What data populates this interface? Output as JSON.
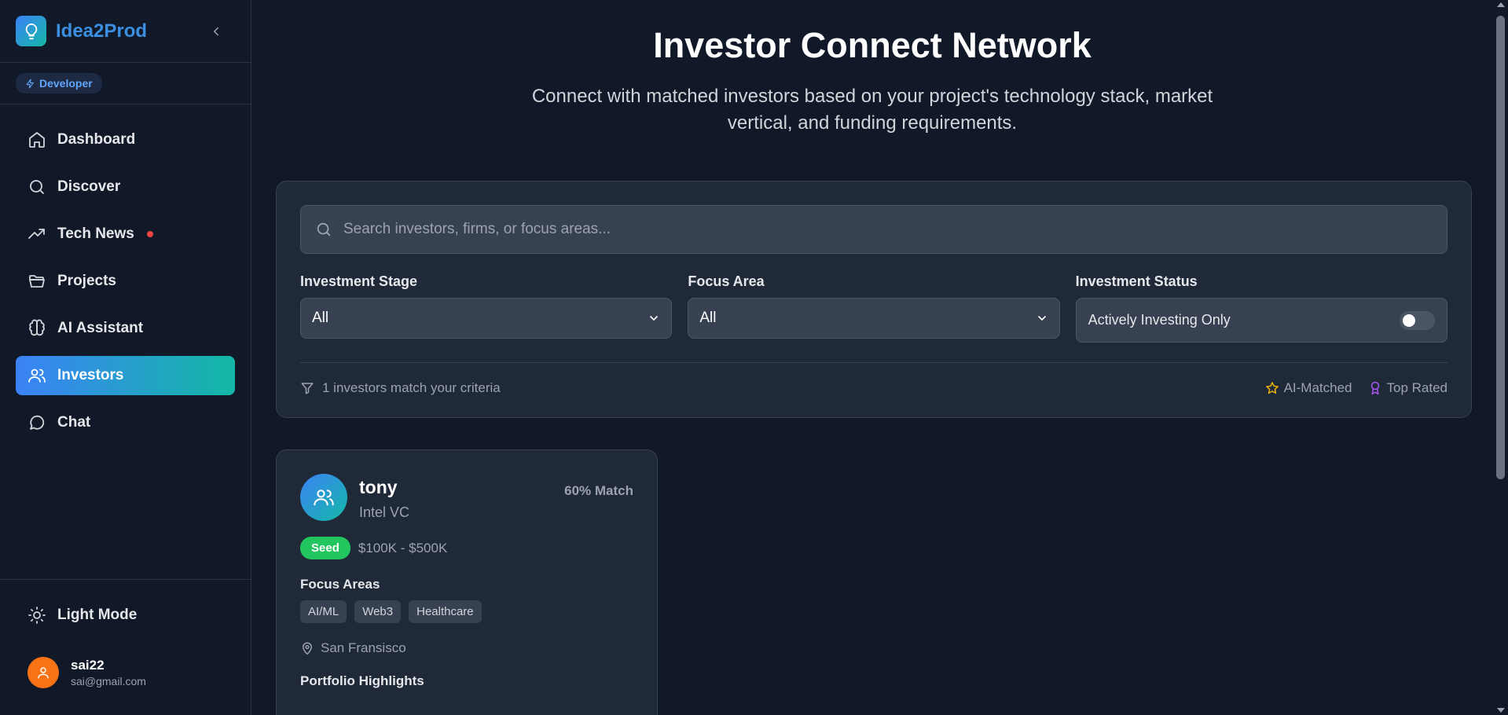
{
  "brand": {
    "name": "Idea2Prod"
  },
  "role": {
    "label": "Developer"
  },
  "nav": {
    "items": [
      {
        "label": "Dashboard",
        "icon": "home-icon"
      },
      {
        "label": "Discover",
        "icon": "search-icon"
      },
      {
        "label": "Tech News",
        "icon": "trending-icon"
      },
      {
        "label": "Projects",
        "icon": "folder-icon"
      },
      {
        "label": "AI Assistant",
        "icon": "brain-icon"
      },
      {
        "label": "Investors",
        "icon": "users-icon",
        "active": true
      },
      {
        "label": "Chat",
        "icon": "chat-icon"
      }
    ]
  },
  "sidebar_bottom": {
    "light_mode": "Light Mode",
    "user": {
      "name": "sai22",
      "email": "sai@gmail.com"
    }
  },
  "header": {
    "title": "Investor Connect Network",
    "subtitle": "Connect with matched investors based on your project's technology stack, market vertical, and funding requirements."
  },
  "filters": {
    "search_placeholder": "Search investors, firms, or focus areas...",
    "stage": {
      "label": "Investment Stage",
      "value": "All"
    },
    "focus": {
      "label": "Focus Area",
      "value": "All"
    },
    "status": {
      "label": "Investment Status",
      "toggle_label": "Actively Investing Only",
      "toggle_on": false
    },
    "result_text": "1 investors match your criteria",
    "legend": {
      "ai_matched": "AI-Matched",
      "top_rated": "Top Rated"
    }
  },
  "investor": {
    "name": "tony",
    "firm": "Intel VC",
    "match": "60% Match",
    "stage": "Seed",
    "range": "$100K - $500K",
    "focus_label": "Focus Areas",
    "focus_areas": [
      "AI/ML",
      "Web3",
      "Healthcare"
    ],
    "location": "San Fransisco",
    "portfolio_label": "Portfolio Highlights"
  },
  "colors": {
    "accent_from": "#3b82f6",
    "accent_to": "#14b8a6",
    "stage_green": "#22c55e",
    "notif_red": "#ef4444",
    "star_yellow": "#eab308",
    "award_purple": "#a855f7",
    "avatar_orange": "#f97316"
  }
}
